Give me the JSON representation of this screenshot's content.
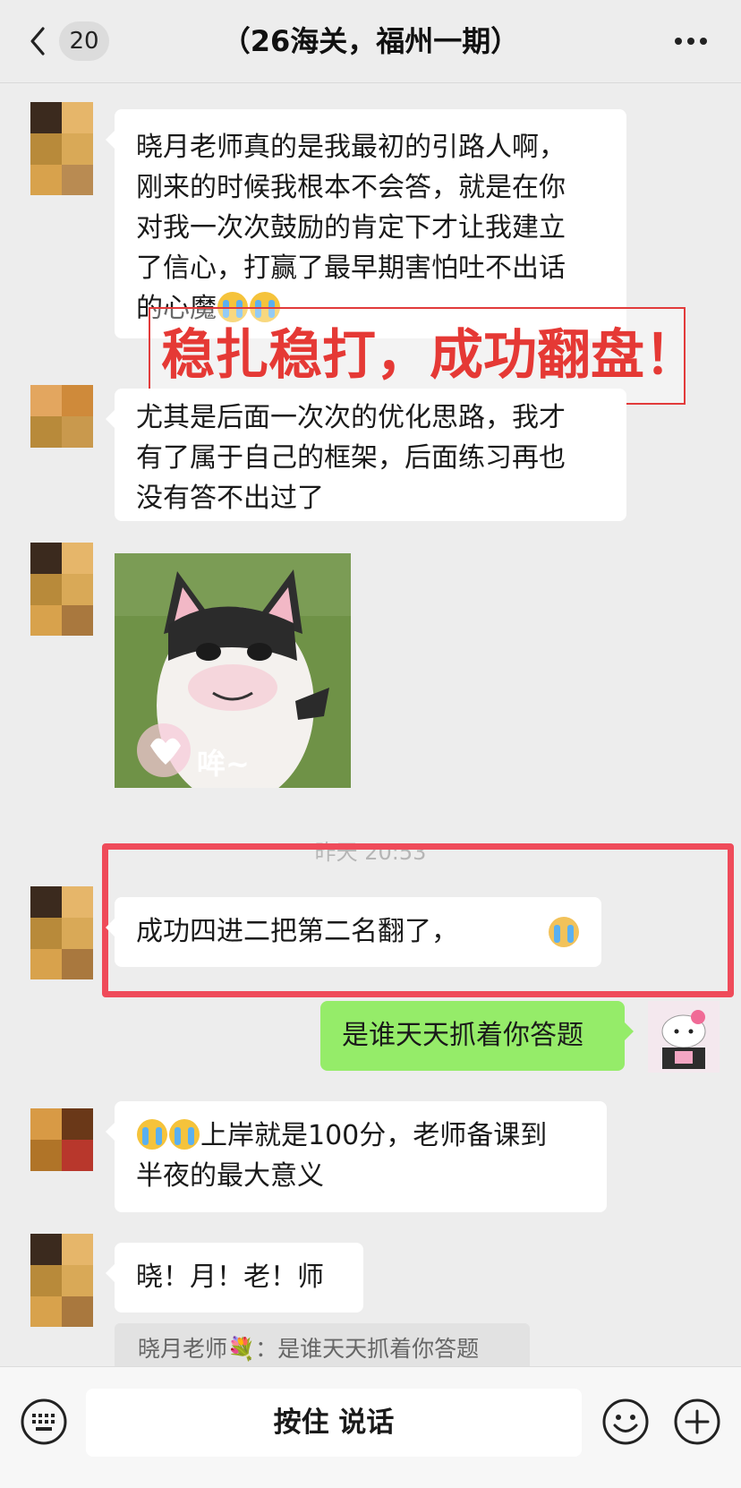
{
  "header": {
    "unread_count": "20",
    "title": "（26海关，福州一期）"
  },
  "messages": [
    {
      "type": "text",
      "lines": [
        "晓月老师真的是我最初的引路人啊，",
        "刚来的时候我根本不会答，就是在你",
        "对我一次次鼓励的肯定下才让我建立",
        "了信心，打赢了最早期害怕吐不出话",
        "的心魔"
      ]
    },
    {
      "type": "text",
      "lines": [
        "尤其是后面一次次的优化思路，我才",
        "有了属于自己的框架，后面练习再也",
        "没有答不出过了"
      ]
    },
    {
      "type": "sticker",
      "caption": "哞~"
    },
    {
      "type": "text",
      "text": "成功四进二把第二名翻了，"
    },
    {
      "type": "text",
      "text": "是谁天天抓着你答题",
      "self": true
    },
    {
      "type": "text",
      "lines": [
        "上岸就是100分，老师备课到",
        "半夜的最大意义"
      ]
    },
    {
      "type": "text",
      "text": "晓！月！老！师"
    }
  ],
  "timestamp": "昨天 20:53",
  "overlay": {
    "headline": "稳扎稳打，成功翻盘！"
  },
  "quote": {
    "text": "晓月老师💐：是谁天天抓着你答题"
  },
  "footer": {
    "talk_label": "按住 说话"
  },
  "colors": {
    "self_bubble": "#95ec69",
    "highlight_red": "#ef4b5a",
    "overlay_text": "#e53935"
  }
}
